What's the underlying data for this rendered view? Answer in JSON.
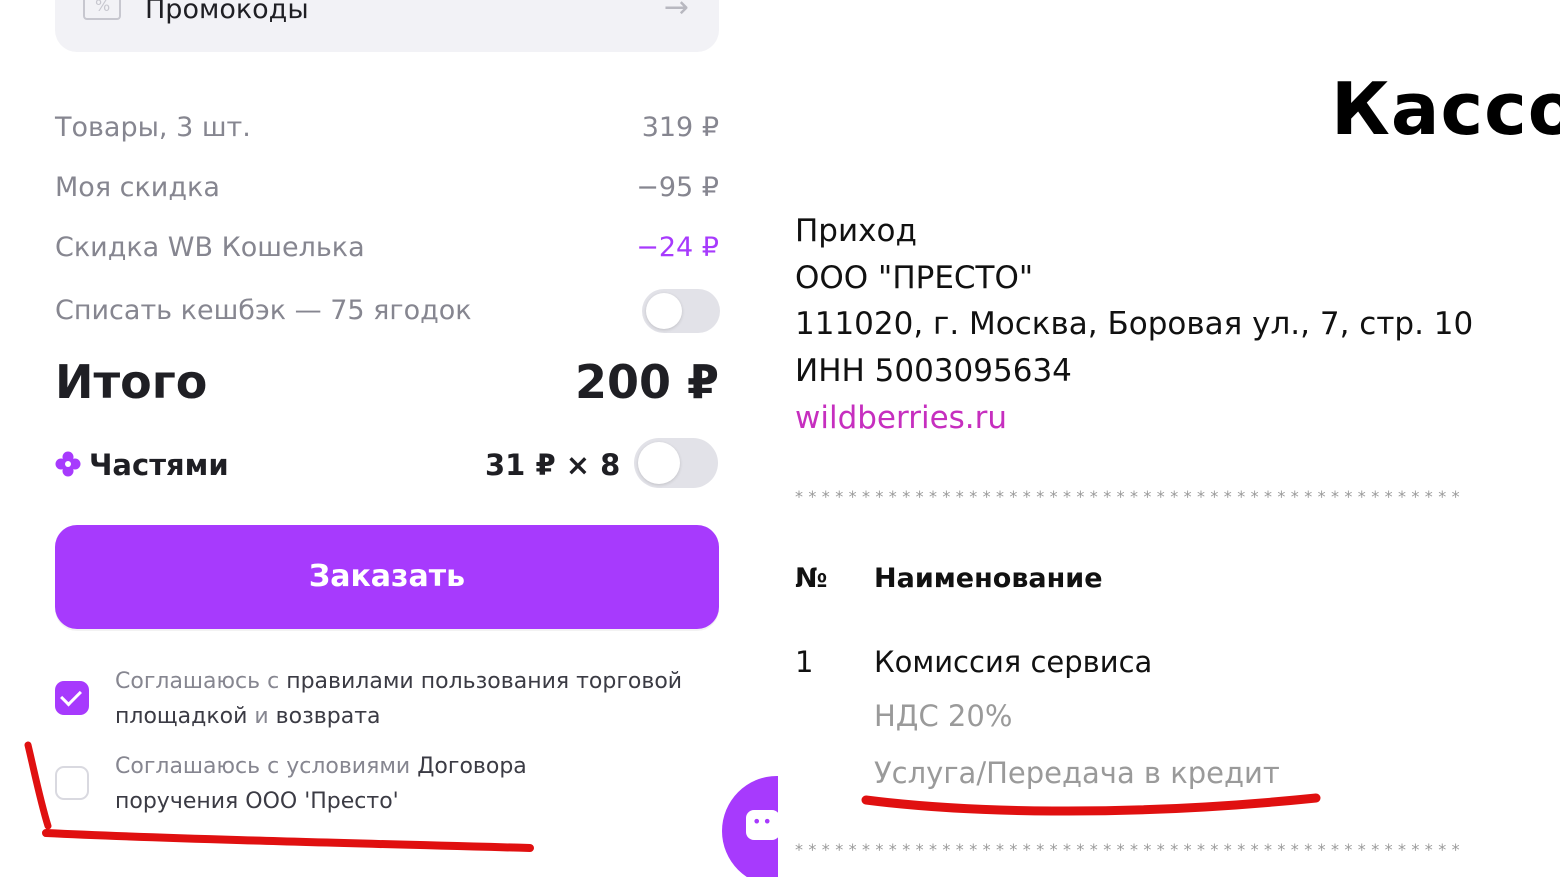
{
  "checkout": {
    "promo_label": "Промокоды",
    "summary": [
      {
        "label": "Товары, 3 шт.",
        "value": "319 ₽"
      },
      {
        "label": "Моя скидка",
        "value": "−95 ₽"
      },
      {
        "label": "Скидка WB Кошелька",
        "value": "−24 ₽"
      }
    ],
    "cashback_label": "Списать кешбэк — 75 ягодок",
    "total_label": "Итого",
    "total_value": "200 ₽",
    "installments_label": "Частями",
    "installments_value": "31 ₽ × 8",
    "order_button": "Заказать",
    "agree1_prefix": "Соглашаюсь с ",
    "agree1_link1": "правилами пользования торговой площадкой",
    "agree1_mid": " и ",
    "agree1_link2": "возврата",
    "agree2_prefix": "Соглашаюсь с условиями ",
    "agree2_link": "Договора поручения ООО 'Престо'"
  },
  "receipt": {
    "title": "Кассов",
    "lines": [
      "Приход",
      "ООО \"ПРЕСТО\"",
      "111020, г. Москва, Боровая ул., 7, стр. 10",
      "ИНН 5003095634"
    ],
    "website": "wildberries.ru",
    "stars": "**************************************************",
    "col_no": "№",
    "col_name": "Наименование",
    "item_no": "1",
    "item_name": "Комиссия сервиса",
    "item_vat": "НДС 20%",
    "item_type": "Услуга/Передача в кредит"
  },
  "colors": {
    "accent": "#a73afd",
    "link": "#c62fbf",
    "marker": "#e01010"
  },
  "icons": [
    "percent-icon",
    "arrow-right-icon",
    "parts-flower-icon",
    "check-icon",
    "chat-icon"
  ]
}
